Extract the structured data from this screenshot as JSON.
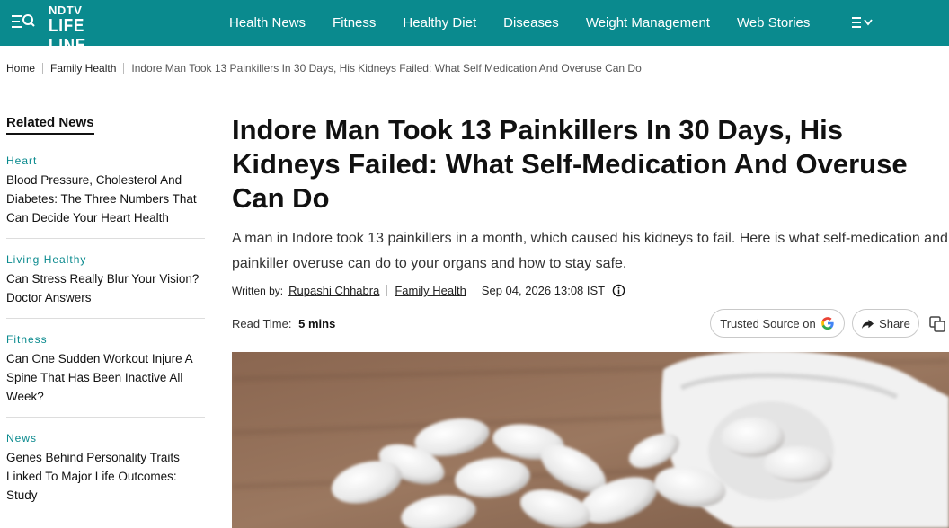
{
  "header": {
    "logo_top": "NDTV",
    "logo_bottom": "LIFE LINE",
    "nav": [
      "Health News",
      "Fitness",
      "Healthy Diet",
      "Diseases",
      "Weight Management",
      "Web Stories"
    ],
    "brand_color": "#0a8a8e"
  },
  "breadcrumb": {
    "home": "Home",
    "category": "Family Health",
    "current": "Indore Man Took 13 Painkillers In 30 Days, His Kidneys Failed: What Self Medication And Overuse Can Do"
  },
  "sidebar": {
    "title": "Related News",
    "items": [
      {
        "category": "Heart",
        "title": "Blood Pressure, Cholesterol And Diabetes: The Three Numbers That Can Decide Your Heart Health"
      },
      {
        "category": "Living Healthy",
        "title": "Can Stress Really Blur Your Vision? Doctor Answers"
      },
      {
        "category": "Fitness",
        "title": "Can One Sudden Workout Injure A Spine That Has Been Inactive All Week?"
      },
      {
        "category": "News",
        "title": "Genes Behind Personality Traits Linked To Major Life Outcomes: Study"
      }
    ]
  },
  "article": {
    "headline": "Indore Man Took 13 Painkillers In 30 Days, His Kidneys Failed: What Self-Medication And Overuse Can Do",
    "summary": "A man in Indore took 13 painkillers in a month, which caused his kidneys to fail. Here is what self-medication and painkiller overuse can do to your organs and how to stay safe.",
    "written_by_label": "Written by:",
    "author": "Rupashi Chhabra",
    "category": "Family Health",
    "date": "Sep 04, 2026 13:08 IST",
    "read_time_label": "Read Time:",
    "read_time": "5 mins",
    "trusted_source_label": "Trusted Source on",
    "share_label": "Share"
  },
  "icons": {
    "menu": "menu-search-icon",
    "more": "hamburger-dropdown-icon",
    "info": "info-icon",
    "google": "google-g-icon",
    "share": "share-arrow-icon",
    "copy": "copy-icon"
  }
}
